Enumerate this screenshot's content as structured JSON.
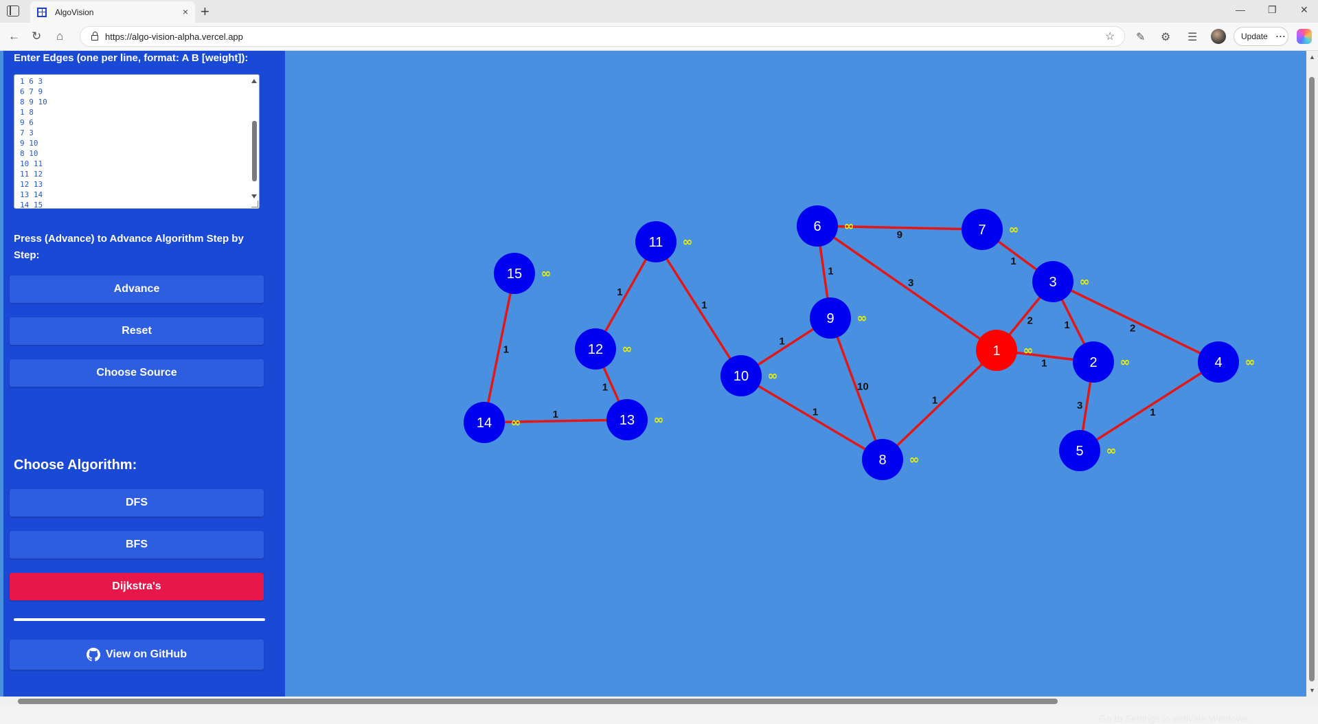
{
  "browser": {
    "tab_title": "AlgoVision",
    "tab_close": "×",
    "new_tab": "+",
    "url": "https://algo-vision-alpha.vercel.app",
    "update_label": "Update",
    "more_label": "···"
  },
  "sidebar": {
    "edges_heading": "Enter Edges (one per line, format: A B [weight]):",
    "edges_text": "1 6 3\n6 7 9\n8 9 10\n1 8\n9 6\n7 3\n9 10\n8 10\n10 11\n11 12\n12 13\n13 14\n14 15",
    "advance_heading": "Press (Advance) to Advance Algorithm Step by Step:",
    "advance_label": "Advance",
    "reset_label": "Reset",
    "choose_source_label": "Choose Source",
    "algo_heading": "Choose Algorithm:",
    "dfs_label": "DFS",
    "bfs_label": "BFS",
    "dijkstra_label": "Dijkstra's",
    "github_label": "View on GitHub"
  },
  "graph": {
    "colors": {
      "node": "#0000f0",
      "source": "#ff0000",
      "edge": "#e01818",
      "dist": "#e8f000",
      "weight": "#111111"
    },
    "source_node": "1",
    "distance_label": "∞",
    "nodes": [
      "1",
      "2",
      "3",
      "4",
      "5",
      "6",
      "7",
      "8",
      "9",
      "10",
      "11",
      "12",
      "13",
      "14",
      "15"
    ],
    "edges": [
      {
        "a": "1",
        "b": "6",
        "w": "3"
      },
      {
        "a": "6",
        "b": "7",
        "w": "9"
      },
      {
        "a": "8",
        "b": "9",
        "w": "10"
      },
      {
        "a": "1",
        "b": "8",
        "w": "1"
      },
      {
        "a": "9",
        "b": "6",
        "w": "1"
      },
      {
        "a": "7",
        "b": "3",
        "w": "1"
      },
      {
        "a": "9",
        "b": "10",
        "w": "1"
      },
      {
        "a": "8",
        "b": "10",
        "w": "1"
      },
      {
        "a": "10",
        "b": "11",
        "w": "1"
      },
      {
        "a": "11",
        "b": "12",
        "w": "1"
      },
      {
        "a": "12",
        "b": "13",
        "w": "1"
      },
      {
        "a": "13",
        "b": "14",
        "w": "1"
      },
      {
        "a": "14",
        "b": "15",
        "w": "1"
      },
      {
        "a": "1",
        "b": "3",
        "w": "2"
      },
      {
        "a": "1",
        "b": "2",
        "w": "1"
      },
      {
        "a": "3",
        "b": "2",
        "w": "1"
      },
      {
        "a": "3",
        "b": "4",
        "w": "2"
      },
      {
        "a": "2",
        "b": "5",
        "w": "3"
      },
      {
        "a": "5",
        "b": "4",
        "w": "1"
      }
    ]
  },
  "watermark": {
    "line1": "Activate Windows",
    "line2": "Go to Settings to activate Windows."
  }
}
